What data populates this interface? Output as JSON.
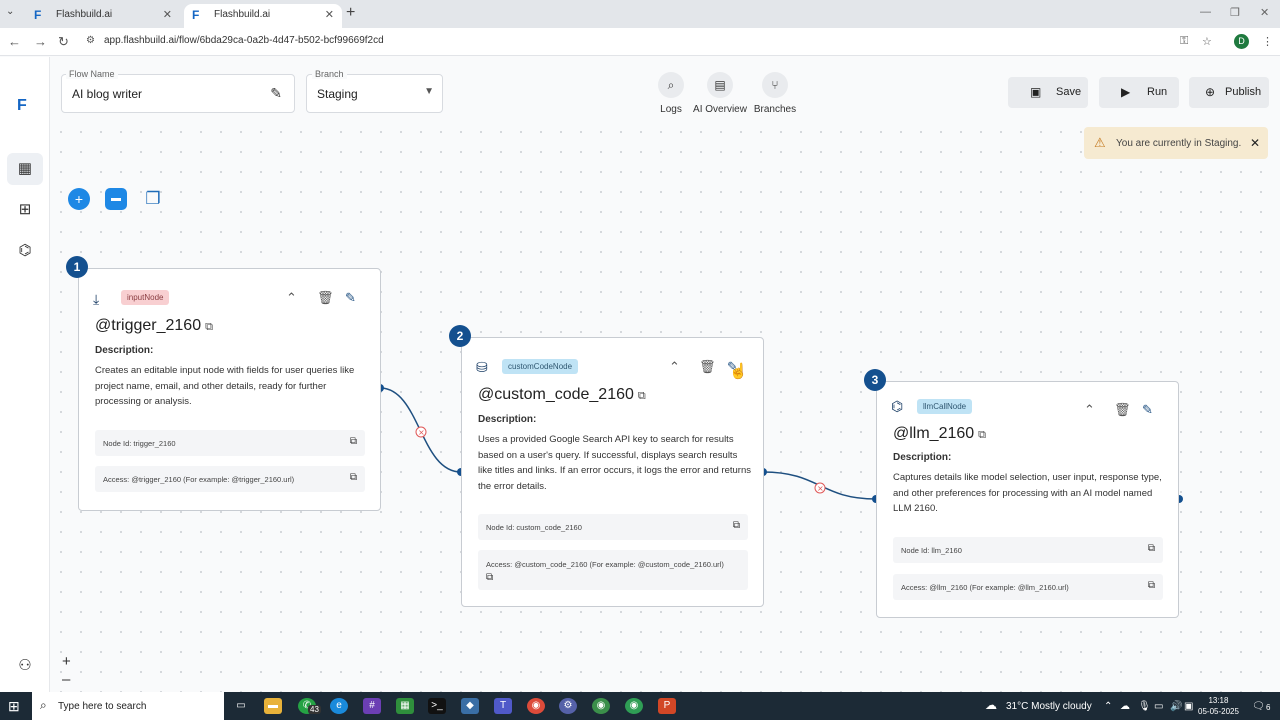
{
  "browser": {
    "tabs": [
      {
        "label": "Flashbuild.ai",
        "active": false
      },
      {
        "label": "Flashbuild.ai",
        "active": true
      }
    ],
    "url": "app.flashbuild.ai/flow/6bda29ca-0a2b-4d47-b502-bcf99669f2cd",
    "profile_initial": "D"
  },
  "header": {
    "flow_name_label": "Flow Name",
    "flow_name_value": "AI blog writer",
    "branch_label": "Branch",
    "branch_value": "Staging",
    "tools": [
      {
        "label": "Logs",
        "icon": "logs-icon"
      },
      {
        "label": "AI Overview",
        "icon": "ai-overview-icon"
      },
      {
        "label": "Branches",
        "icon": "branches-icon"
      }
    ],
    "save_label": "Save",
    "run_label": "Run",
    "publish_label": "Publish"
  },
  "banner": {
    "message": "You are currently in Staging."
  },
  "zoom": {
    "in": "+",
    "out": "–"
  },
  "nodes": [
    {
      "number": "1",
      "type": "inputNode",
      "name": "@trigger_2160",
      "description_heading": "Description:",
      "description": "Creates an editable input node with fields for user queries like project name, email, and other details, ready for further processing or analysis.",
      "node_id": "Node Id: trigger_2160",
      "access": "Access: @trigger_2160 (For example: @trigger_2160.url)"
    },
    {
      "number": "2",
      "type": "customCodeNode",
      "name": "@custom_code_2160",
      "description_heading": "Description:",
      "description": "Uses a provided Google Search API key to search for results based on a user's query. If successful, displays search results like titles and links. If an error occurs, it logs the error and returns the error details.",
      "node_id": "Node Id: custom_code_2160",
      "access": "Access: @custom_code_2160 (For example: @custom_code_2160.url)"
    },
    {
      "number": "3",
      "type": "llmCallNode",
      "name": "@llm_2160",
      "description_heading": "Description:",
      "description": "Captures details like model selection, user input, response type, and other preferences for processing with an AI model named LLM 2160.",
      "node_id": "Node Id: llm_2160",
      "access": "Access: @llm_2160 (For example: @llm_2160.url)"
    }
  ],
  "taskbar": {
    "search_placeholder": "Type here to search",
    "badge": "43",
    "weather": "31°C  Mostly cloudy",
    "time": "13:18",
    "date": "05-05-2025",
    "notifications": "6"
  },
  "colors": {
    "accent": "#14508f",
    "brand": "#1466c4",
    "warning_bg": "#f6ead1"
  }
}
